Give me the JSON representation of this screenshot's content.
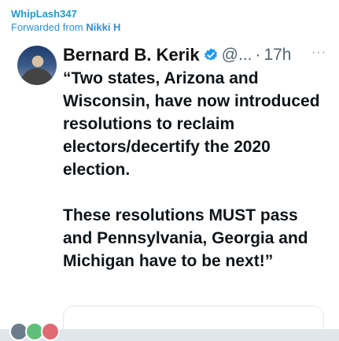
{
  "message": {
    "sender": "WhipLash347",
    "forwarded_prefix": "Forwarded from",
    "forwarded_name": "Nikki H"
  },
  "tweet": {
    "author_name": "Bernard B. Kerik",
    "handle": "@...",
    "separator": "·",
    "time": "17h",
    "more": "···",
    "text": "“Two states, Arizona and Wisconsin, have now introduced resolutions to reclaim electors/decertify the 2020 election.\n\nThese resolutions MUST pass and Pennsylvania, Georgia and Michigan have to be next!”",
    "verified_color": "#1d9bf0"
  },
  "reactions": [
    "#6b7c8c",
    "#5fbf7a",
    "#e06a74"
  ]
}
